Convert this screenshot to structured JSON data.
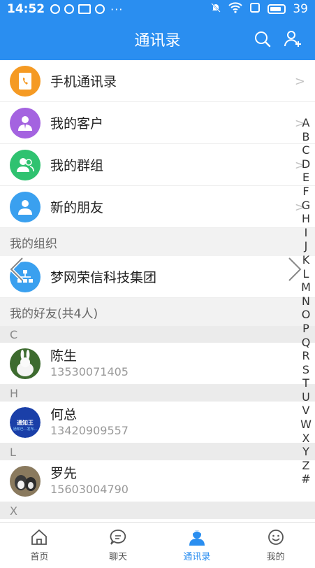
{
  "status_bar": {
    "time": "14:52",
    "battery": "39"
  },
  "header": {
    "title": "通讯录"
  },
  "menu": [
    {
      "label": "手机通讯录",
      "icon": "phonebook-icon",
      "color": "#f59a23"
    },
    {
      "label": "我的客户",
      "icon": "customer-icon",
      "color": "#a463e0"
    },
    {
      "label": "我的群组",
      "icon": "group-icon",
      "color": "#2fc270"
    },
    {
      "label": "新的朋友",
      "icon": "new-friend-icon",
      "color": "#3aa0ef"
    }
  ],
  "org_section": {
    "title": "我的组织",
    "org_name": "梦网荣信科技集团"
  },
  "friends_section": {
    "title": "我的好友(共4人)"
  },
  "groups": [
    {
      "letter": "C",
      "contacts": [
        {
          "name": "陈生",
          "phone": "13530071405"
        }
      ]
    },
    {
      "letter": "H",
      "contacts": [
        {
          "name": "何总",
          "phone": "13420909557"
        }
      ]
    },
    {
      "letter": "L",
      "contacts": [
        {
          "name": "罗先",
          "phone": "15603004790"
        }
      ]
    },
    {
      "letter": "X",
      "contacts": []
    }
  ],
  "avatar_texts": {
    "logo_main": "通知王",
    "logo_sub": "通知已...发布..."
  },
  "alphabet": [
    "A",
    "B",
    "C",
    "D",
    "E",
    "F",
    "G",
    "H",
    "I",
    "J",
    "K",
    "L",
    "M",
    "N",
    "O",
    "P",
    "Q",
    "R",
    "S",
    "T",
    "U",
    "V",
    "W",
    "X",
    "Y",
    "Z",
    "#"
  ],
  "tabs": [
    {
      "label": "首页",
      "icon": "home-icon"
    },
    {
      "label": "聊天",
      "icon": "chat-icon"
    },
    {
      "label": "通讯录",
      "icon": "contacts-icon",
      "active": true
    },
    {
      "label": "我的",
      "icon": "profile-icon"
    }
  ],
  "colors": {
    "primary": "#2a8ef0"
  }
}
